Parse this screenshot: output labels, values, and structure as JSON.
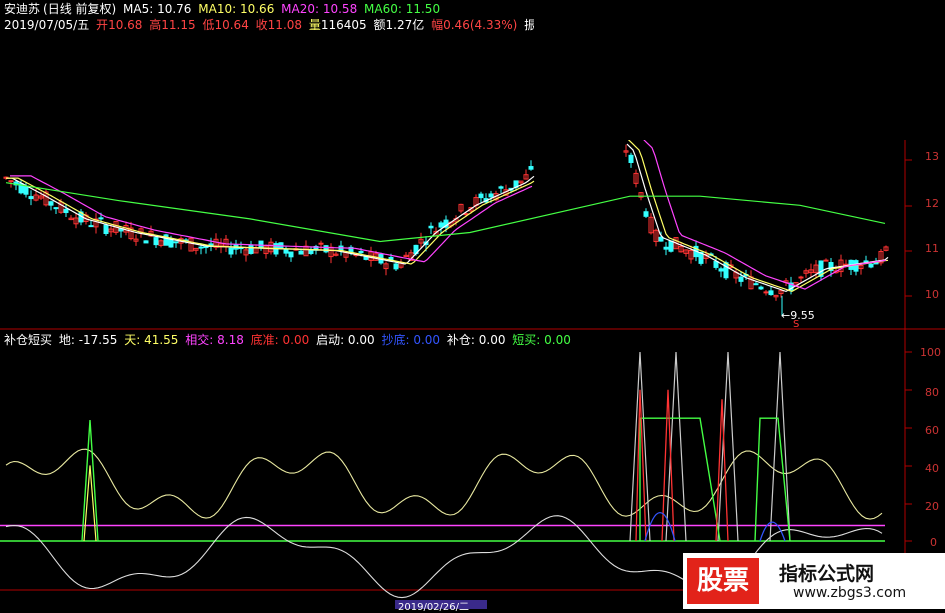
{
  "header": {
    "stock_name": "安迪苏",
    "chart_mode": "(日线 前复权)",
    "ma": [
      {
        "label": "MA5: 10.76",
        "color": "#ffffff"
      },
      {
        "label": "MA10: 10.66",
        "color": "#ffff66"
      },
      {
        "label": "MA20: 10.58",
        "color": "#ff44ff"
      },
      {
        "label": "MA60: 11.50",
        "color": "#44ff44"
      }
    ],
    "date": "2019/07/05/五",
    "ohlc": [
      {
        "label": "开",
        "value": "10.68"
      },
      {
        "label": "高",
        "value": "11.15"
      },
      {
        "label": "低",
        "value": "10.64"
      },
      {
        "label": "收",
        "value": "11.08"
      }
    ],
    "volume_label": "量",
    "volume_value": "116405",
    "amount_label": "额",
    "amount_value": "1.27亿",
    "change_label": "幅",
    "change_value": "0.46(4.33%)",
    "amplitude_label": "振"
  },
  "price_axis": [
    "13",
    "12",
    "11",
    "10"
  ],
  "low_marker": "9.55",
  "low_marker_sub": "S",
  "indicator": {
    "name": "补仓短买",
    "items": [
      {
        "label": "地: -17.55",
        "color": "#ffffff"
      },
      {
        "label": "天: 41.55",
        "color": "#ffff66"
      },
      {
        "label": "相交: 8.18",
        "color": "#ff44ff"
      },
      {
        "label": "底准: 0.00",
        "color": "#ff3333"
      },
      {
        "label": "启动: 0.00",
        "color": "#ffffff"
      },
      {
        "label": "抄底: 0.00",
        "color": "#3355ff"
      },
      {
        "label": "补仓: 0.00",
        "color": "#ffffff"
      },
      {
        "label": "短买: 0.00",
        "color": "#44ff44"
      }
    ]
  },
  "indicator_axis": [
    "100",
    "80",
    "60",
    "40",
    "20",
    "0"
  ],
  "date_axis": "2019/02/26/二",
  "watermark": {
    "logo": "股票",
    "title": "指标公式网",
    "url": "www.zbgs3.com"
  },
  "colors": {
    "up": "#ff3333",
    "down": "#33ffff",
    "ma5": "#ffffff",
    "ma10": "#ffff66",
    "ma20": "#ff44ff",
    "ma60": "#44ff44",
    "axis": "#b00000"
  }
}
